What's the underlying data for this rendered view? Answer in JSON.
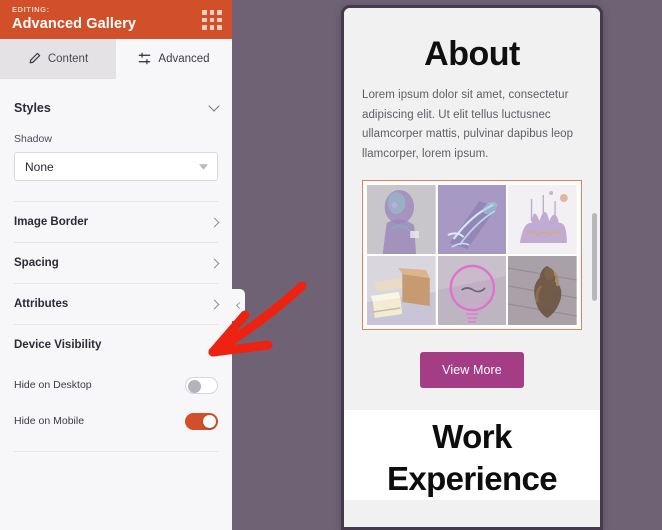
{
  "panel": {
    "header": {
      "editing_label": "EDITING:",
      "title": "Advanced Gallery",
      "grid_icon": "grid-dots-icon",
      "bg_color": "#d1502a"
    },
    "tabs": [
      {
        "label": "Content",
        "icon": "pencil-icon",
        "active": false
      },
      {
        "label": "Advanced",
        "icon": "sliders-icon",
        "active": true
      }
    ],
    "styles_section": {
      "title": "Styles",
      "chevron": "chevron-down-icon",
      "shadow": {
        "label": "Shadow",
        "value": "None",
        "options": [
          "None"
        ],
        "caret": "caret-down-icon"
      }
    },
    "accordion_rows": [
      {
        "label": "Image Border",
        "chevron": "chevron-right-icon"
      },
      {
        "label": "Spacing",
        "chevron": "chevron-right-icon"
      },
      {
        "label": "Attributes",
        "chevron": "chevron-right-icon"
      }
    ],
    "device_visibility": {
      "title": "Device Visibility",
      "toggles": [
        {
          "label": "Hide on Desktop",
          "state": "off",
          "color": "#ffffff"
        },
        {
          "label": "Hide on Mobile",
          "state": "on",
          "color": "#d1502a"
        }
      ]
    },
    "collapse_handle": {
      "icon": "chevron-left-icon"
    }
  },
  "annotation": {
    "arrow": "red-arrow-pointing-down-left",
    "color": "#ee2211"
  },
  "canvas": {
    "bg_color": "#6f6274"
  },
  "preview": {
    "about": {
      "heading": "About",
      "paragraph": "Lorem ipsum dolor sit amet, consectetur adipiscing elit. Ut elit tellus luctusnec ullamcorper mattis, pulvinar dapibus leop llamcorper, lorem ipsum."
    },
    "gallery": {
      "selected": true,
      "selection_color": "#e0845f",
      "columns": 3,
      "rows": 2,
      "images": [
        {
          "name": "sculpture-bust-thumbnail"
        },
        {
          "name": "hand-sketch-thumbnail"
        },
        {
          "name": "coral-abstract-thumbnail"
        },
        {
          "name": "paper-stack-thumbnail"
        },
        {
          "name": "neon-circle-thumbnail"
        },
        {
          "name": "bronze-figure-thumbnail"
        }
      ]
    },
    "view_more_button": {
      "label": "View More",
      "color": "#a43c86"
    },
    "work": {
      "heading": "Work Experience"
    },
    "scrollbar": {
      "name": "preview-scrollbar"
    }
  }
}
